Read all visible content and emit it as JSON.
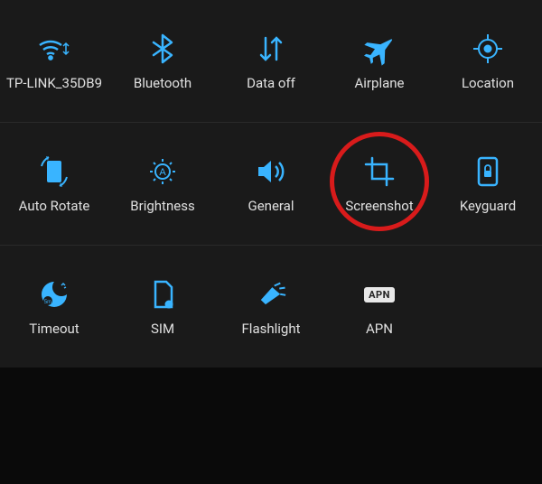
{
  "tiles": {
    "wifi": {
      "label": "TP-LINK_35DB9",
      "icon": "wifi-icon"
    },
    "bluetooth": {
      "label": "Bluetooth",
      "icon": "bluetooth-icon"
    },
    "data": {
      "label": "Data off",
      "icon": "data-icon"
    },
    "airplane": {
      "label": "Airplane",
      "icon": "airplane-icon"
    },
    "location": {
      "label": "Location",
      "icon": "location-icon"
    },
    "autorotate": {
      "label": "Auto Rotate",
      "icon": "rotate-icon"
    },
    "brightness": {
      "label": "Brightness",
      "icon": "brightness-icon"
    },
    "general": {
      "label": "General",
      "icon": "sound-icon"
    },
    "screenshot": {
      "label": "Screenshot",
      "icon": "screenshot-icon",
      "highlighted": true
    },
    "keyguard": {
      "label": "Keyguard",
      "icon": "keyguard-icon"
    },
    "timeout": {
      "label": "Timeout",
      "icon": "timeout-icon"
    },
    "sim": {
      "label": "SIM",
      "icon": "sim-icon"
    },
    "flashlight": {
      "label": "Flashlight",
      "icon": "flashlight-icon"
    },
    "apn": {
      "label": "APN",
      "icon": "apn-icon",
      "badge": "APN"
    }
  },
  "colors": {
    "accent": "#39b4ff",
    "highlight": "#d81b1b"
  }
}
